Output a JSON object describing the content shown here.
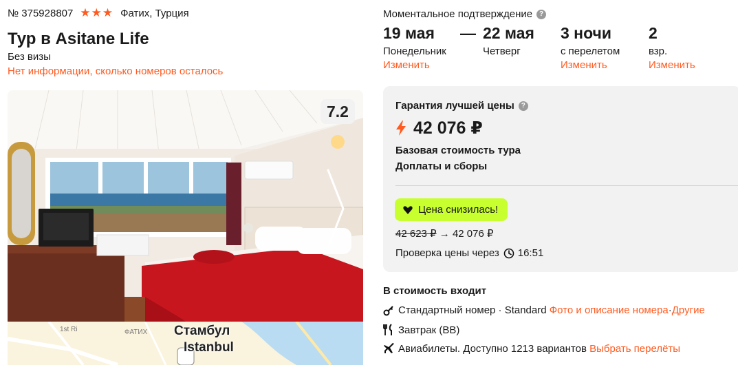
{
  "tour": {
    "id": "№ 375928807",
    "stars": "★★★",
    "location": "Фатих, Турция",
    "title": "Тур в Asitane Life",
    "visa": "Без визы",
    "rooms_info": "Нет информации, сколько номеров осталось",
    "rating": "7.2"
  },
  "map": {
    "city": "Стамбул",
    "city_latin": "Istanbul",
    "street": "1st Ri",
    "district": "ФАТИХ"
  },
  "dates": {
    "confirm_label": "Моментальное подтверждение",
    "help_icon": "?",
    "from_date": "19 мая",
    "from_day": "Понедельник",
    "dash": "—",
    "to_date": "22 мая",
    "to_day": "Четверг",
    "nights": "3 ночи",
    "nights_sub": "с перелетом",
    "adults": "2",
    "adults_sub": "взр.",
    "change": "Изменить"
  },
  "price": {
    "guarantee": "Гарантия лучшей цены",
    "help_icon": "?",
    "amount": "42 076 ₽",
    "base": "Базовая стоимость тура",
    "fees": "Доплаты и сборы",
    "drop_badge": "Цена снизилась!",
    "old_price": "42 623 ₽",
    "arrow": "→",
    "new_price": "42 076 ₽",
    "check_label": "Проверка цены через",
    "check_time": "16:51"
  },
  "includes": {
    "title": "В стоимость входит",
    "room_text": "Стандартный номер · Standard",
    "room_link": "Фото и описание номера",
    "room_sep": " · ",
    "room_other": "Другие",
    "meal": "Завтрак (BB)",
    "flights_text": "Авиабилеты. Доступно 1213 вариантов",
    "flights_link": "Выбрать перелёты"
  },
  "colors": {
    "accent": "#ff5a1f",
    "badge": "#c8ff2e",
    "card_bg": "#f2f2f2"
  }
}
